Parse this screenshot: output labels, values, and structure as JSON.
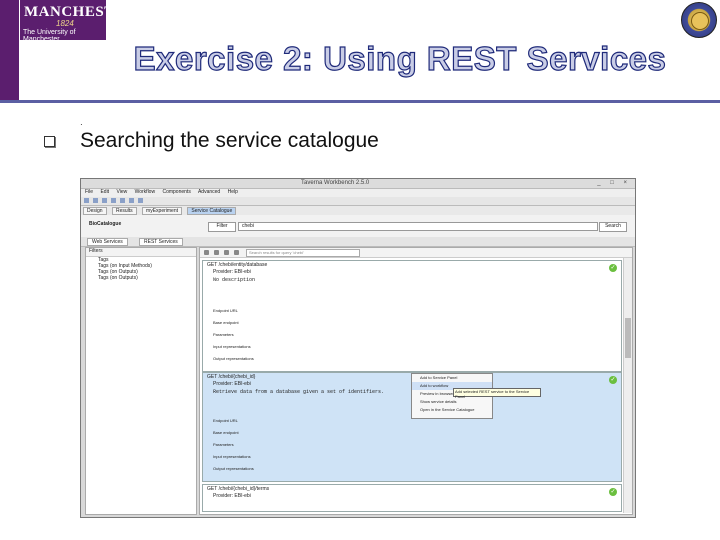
{
  "branding": {
    "logo_line1": "MANCHESTER",
    "logo_year": "1824",
    "logo_line2": "The University of Manchester",
    "side_text": "The University of Manchester"
  },
  "slide": {
    "title": "Exercise 2: Using REST Services",
    "bullet": "Searching the service catalogue"
  },
  "app": {
    "window_title": "Taverna Workbench 2.5.0",
    "menu": [
      "File",
      "Edit",
      "View",
      "Workflow",
      "Components",
      "Advanced",
      "Help"
    ],
    "perspectives": [
      "Design",
      "Results",
      "myExperiment",
      "Service Catalogue"
    ],
    "search_label": "BioCatalogue",
    "search_type_button": "Filter",
    "search_value": "chebi",
    "search_button": "Search",
    "tabs": [
      "Web Services",
      "REST Services"
    ],
    "left_toolbar": "Filters",
    "left_items": [
      "Tags",
      "Tags (on Input Methods)",
      "Tags (on Outputs)",
      "Tags (on Outputs)"
    ],
    "filter_placeholder": "Search results for query 'chebi'",
    "cards": [
      {
        "header": "GET /chebi/entity/database",
        "provider": "Provider: EBI-ebi",
        "description": "No description",
        "meta": [
          "Endpoint URL",
          "Base endpoint",
          "Parameters",
          "Input representations",
          "Output representations"
        ]
      },
      {
        "header": "GET /chebi/{chebi_id}",
        "provider": "Provider: EBI-ebi",
        "description": "Retrieve data from a database given a set of identifiers.",
        "meta": [
          "Endpoint URL",
          "Base endpoint",
          "Parameters",
          "Input representations",
          "Output representations"
        ]
      },
      {
        "header": "GET /chebi/{chebi_id}/terms",
        "provider": "Provider: EBI-ebi"
      }
    ],
    "context_menu": [
      "Add to Service Panel",
      "Add to workflow",
      "Preview in browser",
      "Show service details",
      "Open in the Service Catalogue"
    ],
    "tooltip": "Add selected REST service to the Service Panel"
  }
}
